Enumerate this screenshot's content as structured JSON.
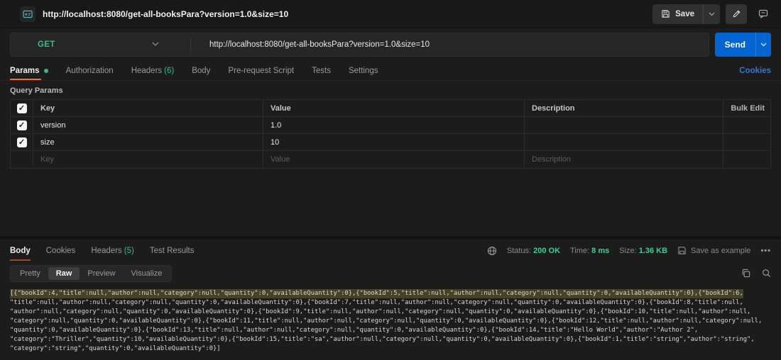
{
  "header": {
    "title": "http://localhost:8080/get-all-booksPara?version=1.0&size=10",
    "save_label": "Save"
  },
  "request": {
    "method": "GET",
    "url": "http://localhost:8080/get-all-booksPara?version=1.0&size=10",
    "send_label": "Send"
  },
  "request_tabs": {
    "params": "Params",
    "authorization": "Authorization",
    "headers": "Headers",
    "headers_count": "(6)",
    "body": "Body",
    "prerequest": "Pre-request Script",
    "tests": "Tests",
    "settings": "Settings",
    "cookies_link": "Cookies"
  },
  "query_params": {
    "section_label": "Query Params",
    "columns": {
      "key": "Key",
      "value": "Value",
      "description": "Description"
    },
    "rows": [
      {
        "key": "version",
        "value": "1.0",
        "description": "",
        "checked": true
      },
      {
        "key": "size",
        "value": "10",
        "description": "",
        "checked": true
      }
    ],
    "placeholder": {
      "key": "Key",
      "value": "Value",
      "description": "Description"
    },
    "more_label": "•••",
    "bulk_edit_label": "Bulk Edit",
    "check_glyph": "✓"
  },
  "response": {
    "tabs": {
      "body": "Body",
      "cookies": "Cookies",
      "headers": "Headers",
      "headers_count": "(5)",
      "test_results": "Test Results"
    },
    "meta": {
      "status_label": "Status:",
      "status_value": "200 OK",
      "time_label": "Time:",
      "time_value": "8 ms",
      "size_label": "Size:",
      "size_value": "1.36 KB",
      "save_as_example": "Save as example",
      "more_label": "•••"
    },
    "view_tabs": {
      "pretty": "Pretty",
      "raw": "Raw",
      "preview": "Preview",
      "visualize": "Visualize"
    },
    "raw_lines": [
      "[{\"bookId\":4,\"title\":null,\"author\":null,\"category\":null,\"quantity\":0,\"availableQuantity\":0},{\"bookId\":5,\"title\":null,\"author\":null,\"category\":null,\"quantity\":0,\"availableQuantity\":0},{\"bookId\":6,",
      "\"title\":null,\"author\":null,\"category\":null,\"quantity\":0,\"availableQuantity\":0},{\"bookId\":7,\"title\":null,\"author\":null,\"category\":null,\"quantity\":0,\"availableQuantity\":0},{\"bookId\":8,\"title\":null,",
      "\"author\":null,\"category\":null,\"quantity\":0,\"availableQuantity\":0},{\"bookId\":9,\"title\":null,\"author\":null,\"category\":null,\"quantity\":0,\"availableQuantity\":0},{\"bookId\":10,\"title\":null,\"author\":null,",
      "\"category\":null,\"quantity\":0,\"availableQuantity\":0},{\"bookId\":11,\"title\":null,\"author\":null,\"category\":null,\"quantity\":0,\"availableQuantity\":0},{\"bookId\":12,\"title\":null,\"author\":null,\"category\":null,",
      "\"quantity\":0,\"availableQuantity\":0},{\"bookId\":13,\"title\":null,\"author\":null,\"category\":null,\"quantity\":0,\"availableQuantity\":0},{\"bookId\":14,\"title\":\"Hello World\",\"author\":\"Author 2\",",
      "\"category\":\"Thriller\",\"quantity\":10,\"availableQuantity\":0},{\"bookId\":15,\"title\":\"sa\",\"author\":null,\"category\":null,\"quantity\":0,\"availableQuantity\":0},{\"bookId\":1,\"title\":\"string\",\"author\":\"string\",",
      "\"category\":\"string\",\"quantity\":0,\"availableQuantity\":0}]"
    ]
  },
  "colors": {
    "accent_orange": "#ff6c37",
    "method_green": "#3fb983",
    "status_green": "#3ecf8e",
    "send_blue": "#0265d2",
    "link_blue": "#3874d8",
    "selection_olive": "#45422a"
  }
}
